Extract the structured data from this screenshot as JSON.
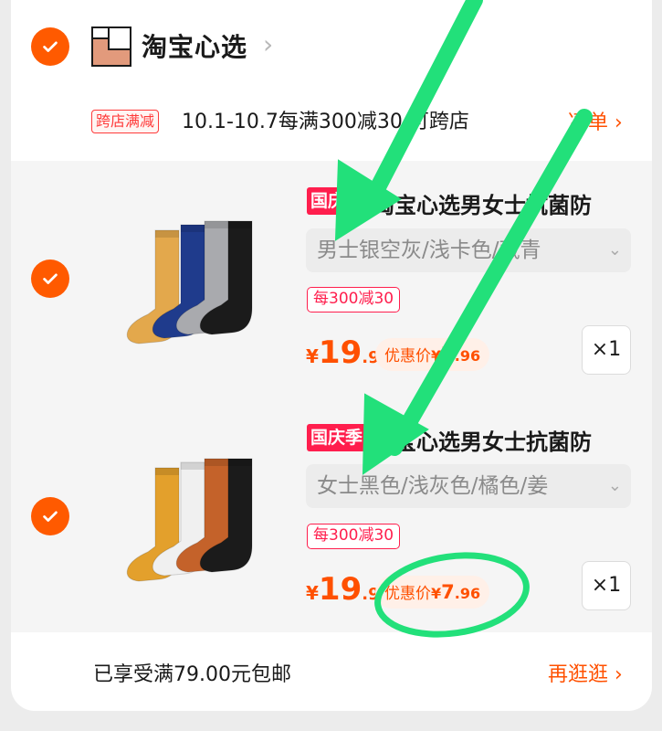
{
  "store": {
    "name": "淘宝心选",
    "chevron": "›"
  },
  "promo": {
    "tag": "跨店满减",
    "text": "10.1-10.7每满300减30 可跨店",
    "link": "凑单 ›"
  },
  "items": [
    {
      "badge": "国庆季",
      "title": "淘宝心选男女士抗菌防",
      "sku": "男士银空灰/浅卡色/藏青",
      "sku_chevron": "⌄",
      "discount_tag": "每300减30",
      "price_currency": "¥",
      "price_int": "19",
      "price_dec": ".9",
      "coupon_label": "优惠价",
      "coupon_currency": "¥",
      "coupon_int": "7",
      "coupon_dec": ".96",
      "qty": "×1",
      "sock_colors": [
        "#e3a84c",
        "#1f3b8c",
        "#a9aaae",
        "#1b1b1b"
      ]
    },
    {
      "badge": "国庆季",
      "title": "淘宝心选男女士抗菌防",
      "sku": "女士黑色/浅灰色/橘色/姜",
      "sku_chevron": "⌄",
      "discount_tag": "每300减30",
      "price_currency": "¥",
      "price_int": "19",
      "price_dec": ".9",
      "coupon_label": "优惠价",
      "coupon_currency": "¥",
      "coupon_int": "7",
      "coupon_dec": ".96",
      "qty": "×1",
      "sock_colors": [
        "#e3a02c",
        "#f0f0f0",
        "#c4622a",
        "#1b1b1b"
      ]
    }
  ],
  "footer": {
    "shipping_text": "已享受满79.00元包邮",
    "more_link": "再逛逛 ›"
  },
  "colors": {
    "accent": "#ff5000",
    "check": "#ff5a00",
    "badge": "#ff1e4d",
    "annotation": "#22e07a"
  }
}
